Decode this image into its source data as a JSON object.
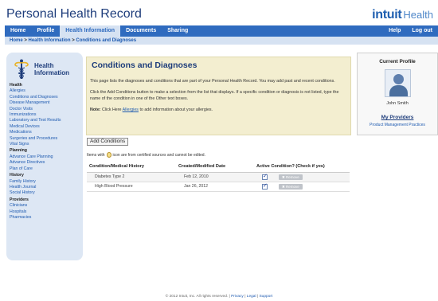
{
  "app_title": "Personal Health Record",
  "brand": {
    "name": "intuit",
    "product": "Health"
  },
  "nav": {
    "tabs": [
      "Home",
      "Profile",
      "Health Information",
      "Documents",
      "Sharing"
    ],
    "active": "Health Information",
    "right": [
      "Help",
      "Log out"
    ]
  },
  "breadcrumb": {
    "home": "Home",
    "sep1": " > ",
    "health": "Health Information",
    "sep2": " > ",
    "current": "Conditions and Diagnoses"
  },
  "sidebar": {
    "title_line1": "Health",
    "title_line2": "Information",
    "sections": [
      {
        "label": "Health",
        "items": [
          "Allergies",
          "Conditions and Diagnoses",
          "Disease Management",
          "Doctor Visits",
          "Immunizations",
          "Laboratory and Test Results",
          "Medical Devices",
          "Medications",
          "Surgeries and Procedures",
          "Vital Signs"
        ]
      },
      {
        "label": "Planning",
        "items": [
          "Advance Care Planning",
          "Advance Directives",
          "Plan of Care"
        ]
      },
      {
        "label": "History",
        "items": [
          "Family History",
          "Health Journal",
          "Social History"
        ]
      },
      {
        "label": "Providers",
        "items": [
          "Clinicians",
          "Hospitals",
          "Pharmacies"
        ]
      }
    ]
  },
  "main": {
    "title": "Conditions and Diagnoses",
    "para1": "This page lists the diagnoses and conditions that are part of your Personal Health Record. You may add past and recent conditions.",
    "para2": "Click the Add Conditions button to make a selection from the list that displays. If a specific condition or diagnosis is not listed, type the name of the condition in one of the Other text boxes.",
    "note_prefix": "Note:",
    "note_mid": " Click Here ",
    "note_link": "Allergies",
    "note_suffix": " to add information about your allergies.",
    "add_button": "Add Conditions",
    "cert_prefix": "Items with",
    "cert_suffix": "icon are from certified sources and cannot be edited.",
    "table": {
      "headers": [
        "Condition/Medical History",
        "Created/Modified Date",
        "Active Condition? (Check if yes)"
      ],
      "rows": [
        {
          "condition": "Diabetes Type 2",
          "date": "Feb 12, 2010",
          "active": true,
          "remove": "Remove"
        },
        {
          "condition": "High Blood Pressure",
          "date": "Jan 26, 2012",
          "active": true,
          "remove": "Remove"
        }
      ]
    }
  },
  "profile": {
    "title": "Current Profile",
    "name": "John Smith",
    "providers_label": "My Providers",
    "provider": "Product Management Practices"
  },
  "footer": {
    "copyright": "© 2012 Intuit, Inc. All rights reserved.",
    "sep": "|",
    "links": [
      "Privacy",
      "Legal",
      "Support"
    ]
  },
  "colors": {
    "nav": "#2f6bbf",
    "title": "#1e3d7b",
    "panel": "#f3eed0",
    "sidebar": "#dde7f4"
  }
}
